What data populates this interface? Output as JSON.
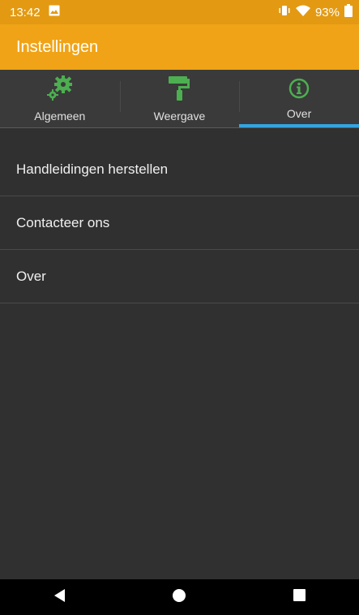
{
  "status_bar": {
    "time": "13:42",
    "battery_percent": "93%",
    "icons": [
      "image-notification-icon",
      "vibrate-icon",
      "wifi-icon",
      "battery-icon"
    ]
  },
  "app_bar": {
    "title": "Instellingen"
  },
  "tabs": [
    {
      "label": "Algemeen",
      "icon": "gears-icon",
      "selected": false
    },
    {
      "label": "Weergave",
      "icon": "paint-roller-icon",
      "selected": false
    },
    {
      "label": "Over",
      "icon": "info-icon",
      "selected": true
    }
  ],
  "list": {
    "items": [
      {
        "label": "Handleidingen herstellen"
      },
      {
        "label": "Contacteer ons"
      },
      {
        "label": "Over"
      }
    ]
  },
  "nav_bar": {
    "buttons": [
      "back-icon",
      "home-icon",
      "recents-icon"
    ]
  },
  "colors": {
    "status_bar": "#e39a12",
    "app_bar": "#f0a316",
    "background": "#303030",
    "tab_bar": "#3a3a3a",
    "icon_green": "#4caf50",
    "tab_indicator": "#35a4e0"
  }
}
